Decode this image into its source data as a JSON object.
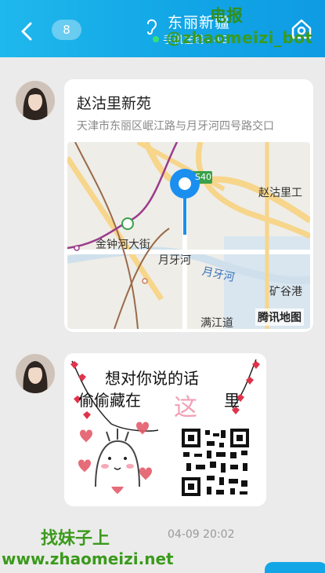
{
  "header": {
    "back_count": "8",
    "title": "东丽新疆",
    "status": "手机在线 - 4G",
    "colors": {
      "bar": "#12a6e6",
      "online": "#36e07a"
    }
  },
  "watermarks": {
    "top_line1": "电报",
    "top_line2": "@zhaomeizi_bot",
    "bottom_line1": "找妹子上",
    "bottom_line2": "www.zhaomeizi.net"
  },
  "messages": [
    {
      "type": "location",
      "name": "赵沽里新苑",
      "address": "天津市东丽区岷江路与月牙河四号路交口",
      "map": {
        "labels": {
          "road_s40": "S40",
          "zhaoguli": "赵沽里工",
          "jinzhonghe": "金钟河大街",
          "yueyahe1": "月牙河",
          "yueyahe2": "月牙河",
          "kuanggu": "矿谷港",
          "manjiang": "满江道"
        },
        "provider": "腾讯地图"
      }
    },
    {
      "type": "image",
      "line1": "想对你说的话",
      "line2": "偷偷藏在",
      "here": "这",
      "tail": "里"
    }
  ],
  "timestamp": "04-09 20:02"
}
